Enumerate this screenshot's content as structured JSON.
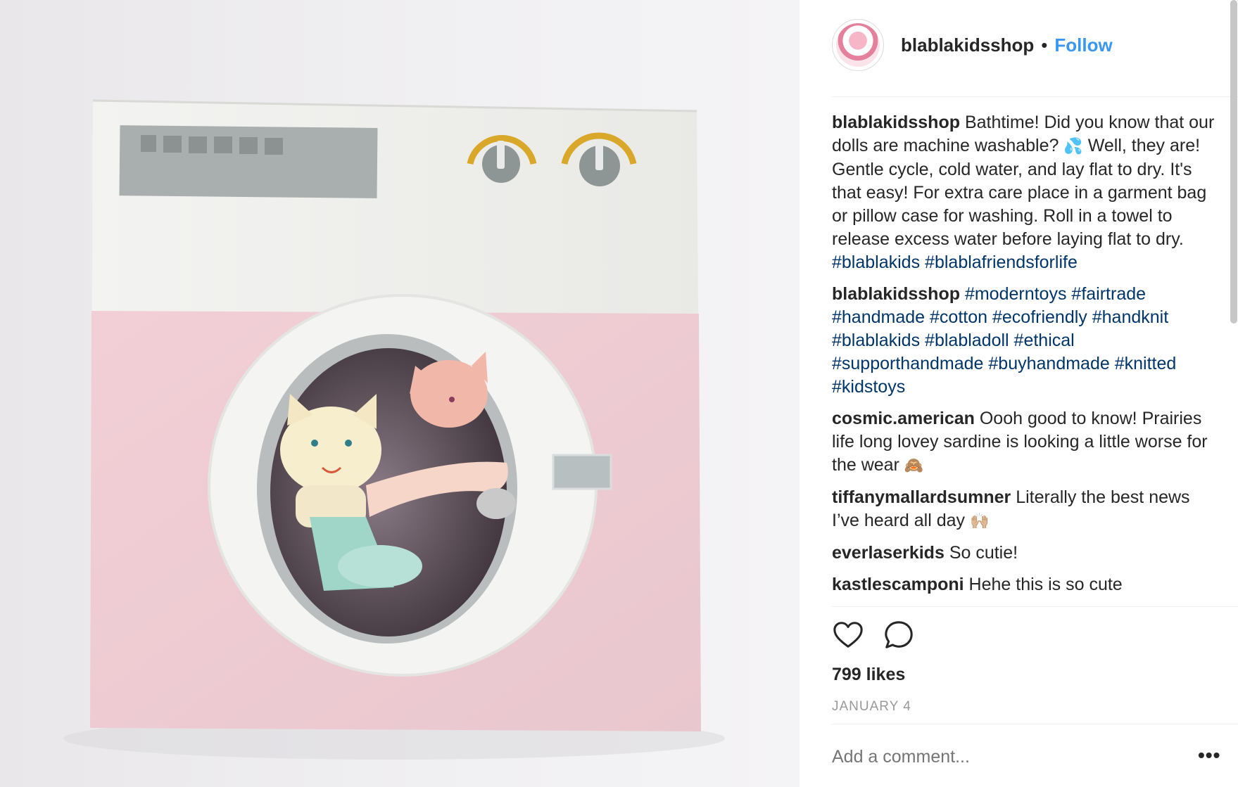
{
  "post": {
    "username": "blablakidsshop",
    "separator": "•",
    "follow_label": "Follow",
    "likes": "799 likes",
    "date": "JANUARY 4",
    "add_comment_placeholder": "Add a comment...",
    "more_label": "•••"
  },
  "comments": [
    {
      "user": "blablakidsshop",
      "text": "Bathtime! Did you know that our dolls are machine washable?",
      "emoji1": "💦",
      "text2": "Well, they are! Gentle cycle, cold water, and lay flat to dry. It's that easy! For extra care place in a garment bag or pillow case for washing. Roll in a towel to release excess water before laying flat to dry.",
      "tags": [
        "#blablakids",
        "#blablafriendsforlife"
      ]
    },
    {
      "user": "blablakidsshop",
      "tags": [
        "#moderntoys",
        "#fairtrade",
        "#handmade",
        "#cotton",
        "#ecofriendly",
        "#handknit",
        "#blablakids",
        "#blabladoll",
        "#ethical",
        "#supporthandmade",
        "#buyhandmade",
        "#knitted",
        "#kidstoys"
      ]
    },
    {
      "user": "cosmic.american",
      "text": "Oooh good to know! Prairies life long lovey sardine is looking a little worse for the wear",
      "emoji": "🙈"
    },
    {
      "user": "tiffanymallardsumner",
      "text": "Literally the best news I’ve heard all day",
      "emoji": "🙌🏼"
    },
    {
      "user": "everlaserkids",
      "text": "So cutie!"
    },
    {
      "user": "kastlescamponi",
      "text": "Hehe this is so cute"
    }
  ],
  "icons": {
    "like": "heart-icon",
    "comment": "comment-bubble-icon",
    "avatar": "profile-avatar"
  },
  "colors": {
    "link_blue": "#3897f0",
    "hashtag": "#003569",
    "muted": "#999999"
  }
}
